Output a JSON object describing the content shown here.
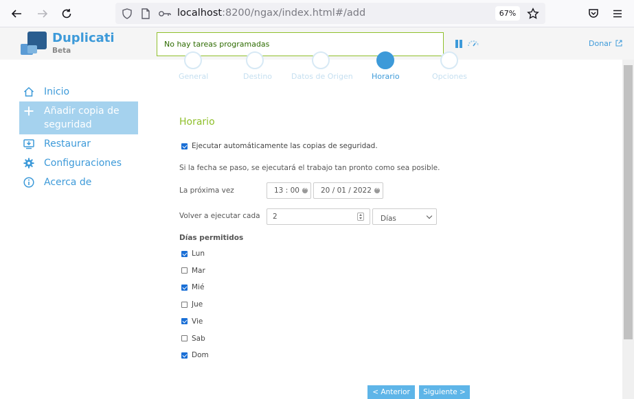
{
  "browser": {
    "url_host": "localhost",
    "url_rest": ":8200/ngax/index.html#/add",
    "zoom": "67%"
  },
  "header": {
    "app_name": "Duplicati",
    "app_channel": "Beta",
    "status": "No hay tareas programadas",
    "donate": "Donar"
  },
  "sidebar": {
    "items": [
      {
        "label": "Inicio",
        "icon": "home-icon"
      },
      {
        "label": "Añadir copia de seguridad",
        "icon": "plus-icon"
      },
      {
        "label": "Restaurar",
        "icon": "restore-icon"
      },
      {
        "label": "Configuraciones",
        "icon": "gear-icon"
      },
      {
        "label": "Acerca de",
        "icon": "info-icon"
      }
    ]
  },
  "steps": [
    {
      "label": "General"
    },
    {
      "label": "Destino"
    },
    {
      "label": "Datos de Origen"
    },
    {
      "label": "Horario"
    },
    {
      "label": "Opciones"
    }
  ],
  "schedule": {
    "title": "Horario",
    "auto_run_label": "Ejecutar automáticamente las copias de seguridad.",
    "auto_run_checked": true,
    "hint": "Si la fecha se paso, se ejecutará el trabajo tan pronto como sea posible.",
    "next_label": "La próxima vez",
    "next_time": "13 : 00",
    "next_date": "20 / 01 / 2022",
    "repeat_label": "Volver a ejecutar cada",
    "repeat_value": "2",
    "repeat_unit": "Días",
    "days_title": "Días permitidos",
    "days": [
      {
        "label": "Lun",
        "checked": true
      },
      {
        "label": "Mar",
        "checked": false
      },
      {
        "label": "Mié",
        "checked": true
      },
      {
        "label": "Jue",
        "checked": false
      },
      {
        "label": "Vie",
        "checked": true
      },
      {
        "label": "Sab",
        "checked": false
      },
      {
        "label": "Dom",
        "checked": true
      }
    ]
  },
  "buttons": {
    "prev": "< Anterior",
    "next": "Siguiente >"
  },
  "colors": {
    "accent": "#3d9ad9",
    "green": "#8fbf2a",
    "active_nav": "#a5d2ee"
  }
}
